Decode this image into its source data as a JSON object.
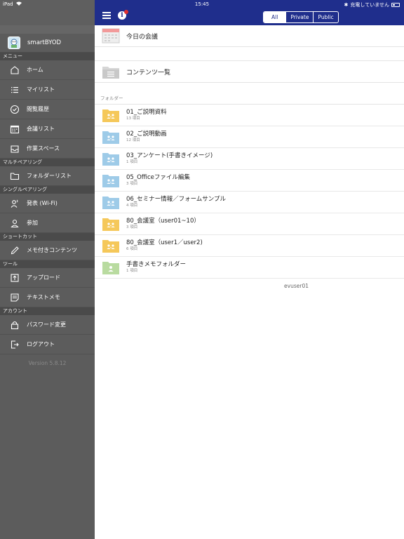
{
  "status_bar": {
    "device": "iPad",
    "time": "15:45",
    "charging_text": "充電していません"
  },
  "sidebar": {
    "app_name": "smartBYOD",
    "sections": [
      {
        "title": "メニュー",
        "items": [
          {
            "label": "ホーム",
            "icon": "home-icon"
          },
          {
            "label": "マイリスト",
            "icon": "list-icon"
          },
          {
            "label": "閲覧履歴",
            "icon": "check-circle-icon"
          },
          {
            "label": "会議リスト",
            "icon": "calendar-icon"
          },
          {
            "label": "作業スペース",
            "icon": "inbox-icon"
          }
        ]
      },
      {
        "title": "マルチペアリング",
        "items": [
          {
            "label": "フォルダーリスト",
            "icon": "folder-icon"
          }
        ]
      },
      {
        "title": "シングルペアリング",
        "items": [
          {
            "label": "発表 (Wi-Fi)",
            "icon": "presenter-icon"
          },
          {
            "label": "参加",
            "icon": "user-icon"
          }
        ]
      },
      {
        "title": "ショートカット",
        "items": [
          {
            "label": "メモ付きコンテンツ",
            "icon": "pencil-icon"
          }
        ]
      },
      {
        "title": "ツール",
        "items": [
          {
            "label": "アップロード",
            "icon": "upload-icon"
          },
          {
            "label": "テキストメモ",
            "icon": "note-icon"
          }
        ]
      },
      {
        "title": "アカウント",
        "items": [
          {
            "label": "パスワード変更",
            "icon": "lock-icon"
          },
          {
            "label": "ログアウト",
            "icon": "logout-icon"
          }
        ]
      }
    ],
    "version": "Version 5.8.12"
  },
  "navbar": {
    "segments": [
      "All",
      "Private",
      "Public"
    ],
    "selected_segment": "All"
  },
  "main": {
    "today_meeting_label": "今日の会議",
    "content_list_label": "コンテンツ一覧",
    "folder_section_label": "フォルダー",
    "folders": [
      {
        "name": "01_ご説明資料",
        "count": "13 項目",
        "color": "yellow"
      },
      {
        "name": "02_ご説明動画",
        "count": "12 項目",
        "color": "blue"
      },
      {
        "name": "03_アンケート(手書きイメージ)",
        "count": "1 項目",
        "color": "blue"
      },
      {
        "name": "05_Officeファイル編集",
        "count": "3 項目",
        "color": "blue"
      },
      {
        "name": "06_セミナー情報／フォームサンプル",
        "count": "4 項目",
        "color": "blue"
      },
      {
        "name": "80_会議室（user01~10）",
        "count": "3 項目",
        "color": "yellow"
      },
      {
        "name": "80_会議室（user1／user2)",
        "count": "6 項目",
        "color": "yellow"
      },
      {
        "name": "手書きメモフォルダー",
        "count": "1 項目",
        "color": "green"
      }
    ],
    "username": "evuser01"
  },
  "colors": {
    "navbar": "#1f2e8c",
    "sidebar": "#5c5c5c",
    "folder_yellow": "#f5c85a",
    "folder_blue": "#9ecbe8",
    "folder_green": "#b8dba0"
  }
}
